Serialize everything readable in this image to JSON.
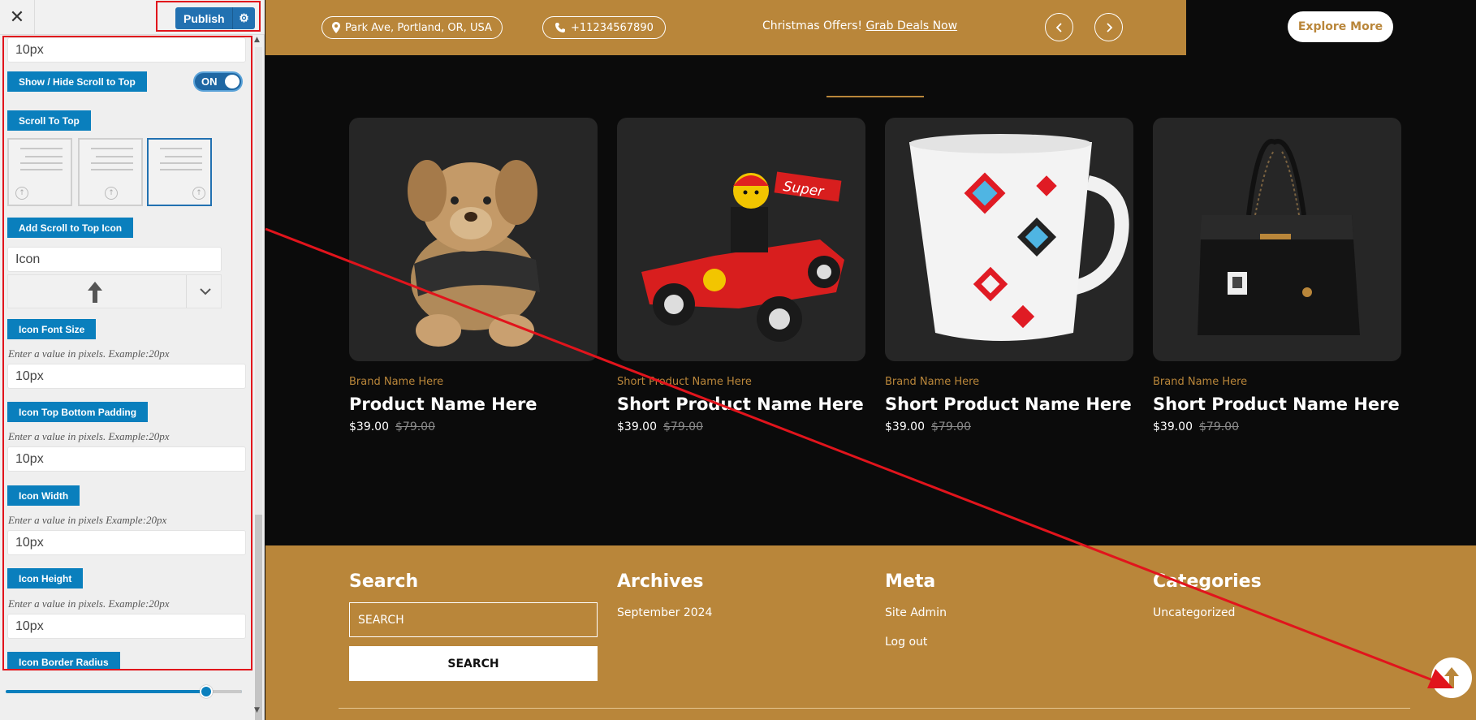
{
  "customizer": {
    "close_glyph": "✕",
    "publish_label": "Publish",
    "padding_value": "10px",
    "show_hide_label": "Show / Hide Scroll to Top",
    "toggle_state": "ON",
    "scroll_to_top_label": "Scroll To Top",
    "layout_options": [
      "layout-1",
      "layout-2",
      "layout-3"
    ],
    "selected_layout": "layout-3",
    "add_icon_label": "Add Scroll to Top Icon",
    "icon_field_placeholder": "Icon",
    "selected_icon": "arrow-up-icon",
    "icon_font_size_label": "Icon Font Size",
    "icon_font_size_hint": "Enter a value in pixels. Example:20px",
    "icon_font_size_value": "10px",
    "icon_padding_label": "Icon Top Bottom Padding",
    "icon_padding_hint": "Enter a value in pixels. Example:20px",
    "icon_padding_value": "10px",
    "icon_width_label": "Icon Width",
    "icon_width_hint": "Enter a value in pixels Example:20px",
    "icon_width_value": "10px",
    "icon_height_label": "Icon Height",
    "icon_height_hint": "Enter a value in pixels. Example:20px",
    "icon_height_value": "10px",
    "icon_border_radius_label": "Icon Border Radius",
    "border_radius_slider_fraction": 0.85
  },
  "site": {
    "colors": {
      "accent": "#b9863a",
      "dark": "#0b0b0b",
      "card": "#262626",
      "highlight": "#e1141c"
    },
    "topbar": {
      "address": "Park Ave, Portland, OR, USA",
      "phone": "+11234567890",
      "offer_text": "Christmas Offers! ",
      "offer_link": "Grab Deals Now",
      "explore_label": "Explore More"
    },
    "products": [
      {
        "brand": "Brand Name Here",
        "name": "Product Name Here",
        "price": "$39.00",
        "old_price": "$79.00",
        "image": "teddy-bear"
      },
      {
        "brand": "Short Product Name Here",
        "name": "Short Product Name Here",
        "price": "$39.00",
        "old_price": "$79.00",
        "image": "lego-race-car"
      },
      {
        "brand": "Brand Name Here",
        "name": "Short Product Name Here",
        "price": "$39.00",
        "old_price": "$79.00",
        "image": "patterned-mug"
      },
      {
        "brand": "Brand Name Here",
        "name": "Short Product Name Here",
        "price": "$39.00",
        "old_price": "$79.00",
        "image": "black-handbag"
      }
    ],
    "footer": {
      "search_title": "Search",
      "search_placeholder": "SEARCH",
      "search_button": "SEARCH",
      "archives_title": "Archives",
      "archives_items": [
        "September 2024"
      ],
      "meta_title": "Meta",
      "meta_items": [
        "Site Admin",
        "Log out"
      ],
      "categories_title": "Categories",
      "categories_items": [
        "Uncategorized"
      ]
    }
  }
}
